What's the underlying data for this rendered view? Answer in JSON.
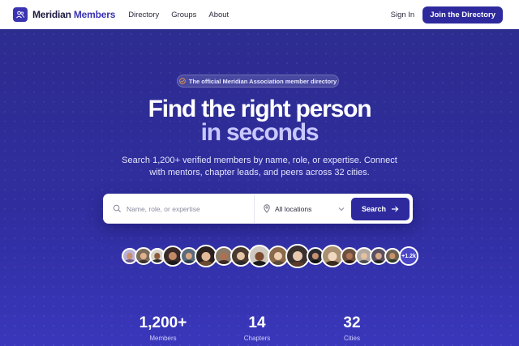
{
  "nav": {
    "brand_part1": "Meridian",
    "brand_part2": "Members",
    "links": [
      "Directory",
      "Groups",
      "About"
    ],
    "signin": "Sign In",
    "cta": "Join the Directory"
  },
  "hero": {
    "badge": "The official Meridian Association member directory",
    "title_line1": "Find the right person",
    "title_line2": "in seconds",
    "subtitle": "Search 1,200+ verified members by name, role, or expertise. Connect with mentors, chapter leads, and peers across 32 cities."
  },
  "search": {
    "placeholder": "Name, role, or expertise",
    "location_value": "All locations",
    "button_label": "Search"
  },
  "avatars": {
    "more_label": "+1.2k"
  },
  "stats": [
    {
      "value": "1,200+",
      "label": "Members"
    },
    {
      "value": "14",
      "label": "Chapters"
    },
    {
      "value": "32",
      "label": "Cities"
    }
  ],
  "colors": {
    "brand": "#2e2a9e",
    "hero_bg": "#2d2c8f",
    "accent_text": "#c9c8ff"
  }
}
